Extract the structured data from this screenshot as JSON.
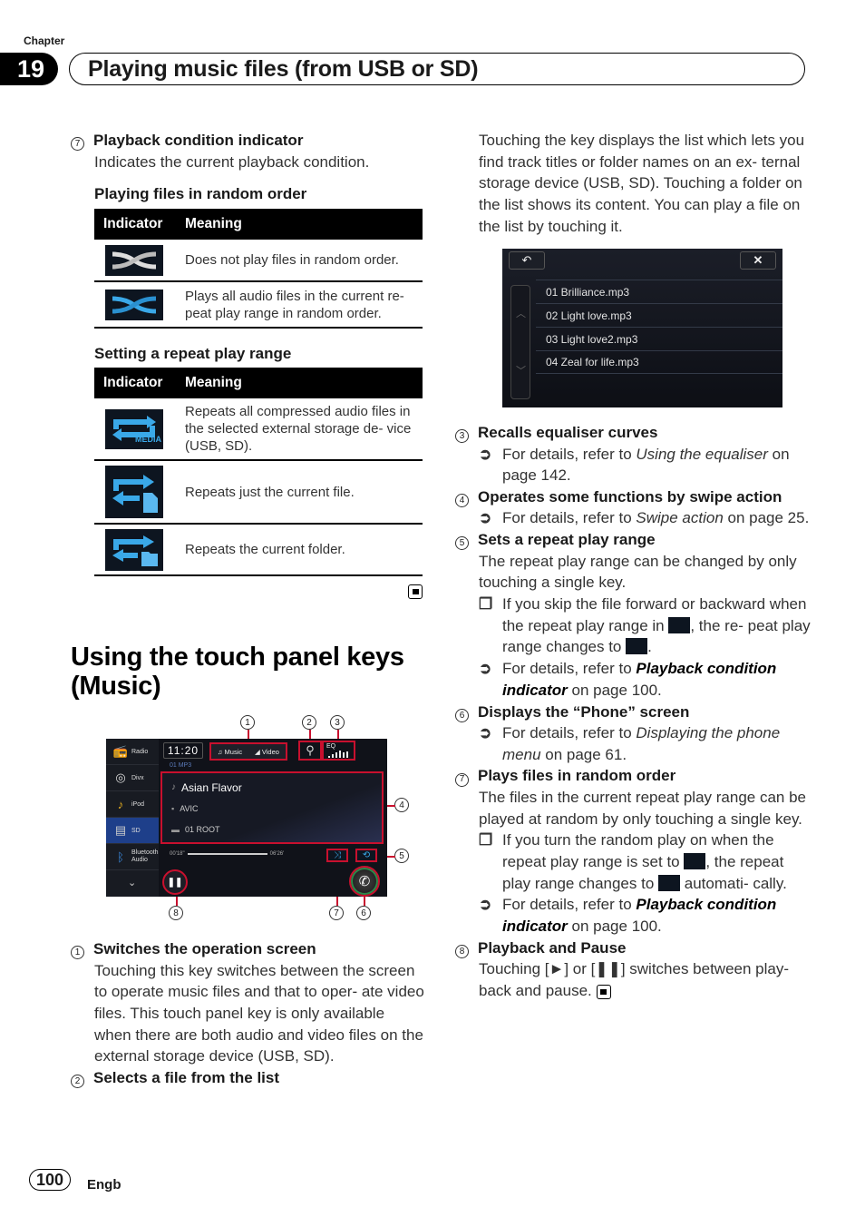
{
  "header": {
    "chapter_label": "Chapter",
    "chapter_number": "19",
    "chapter_title": "Playing music files (from USB or SD)"
  },
  "left": {
    "item7": {
      "num": "7",
      "title": "Playback condition indicator",
      "desc": "Indicates the current playback condition."
    },
    "random_table": {
      "heading": "Playing files in random order",
      "col_indicator": "Indicator",
      "col_meaning": "Meaning",
      "rows": [
        {
          "icon": "shuffle-off-icon",
          "meaning": "Does not play files in random order."
        },
        {
          "icon": "shuffle-on-icon",
          "meaning": "Plays all audio files in the current re- peat play range in random order."
        }
      ]
    },
    "repeat_table": {
      "heading": "Setting a repeat play range",
      "col_indicator": "Indicator",
      "col_meaning": "Meaning",
      "rows": [
        {
          "icon": "repeat-media-icon",
          "icon_label": "MEDIA",
          "meaning": "Repeats all compressed audio files in the selected external storage de- vice (USB, SD)."
        },
        {
          "icon": "repeat-file-icon",
          "meaning": "Repeats just the current file."
        },
        {
          "icon": "repeat-folder-icon",
          "meaning": "Repeats the current folder."
        }
      ]
    },
    "section_heading_line1": "Using the touch panel keys",
    "section_heading_line2": "(Music)",
    "screen": {
      "sidebar": [
        "Radio",
        "Divx",
        "iPod",
        "SD",
        "Bluetooth Audio"
      ],
      "active_source": "SD",
      "clock": "11:20",
      "toggle_music": "♫ Music",
      "toggle_video": "◢ Video",
      "eq_label": "EQ",
      "track_no": "01    MP3",
      "song": "Asian Flavor",
      "artist": "AVIC",
      "folder": "01 ROOT",
      "elapsed": "00'18\"",
      "total": "06'26'",
      "callouts": [
        "1",
        "2",
        "3",
        "4",
        "5",
        "6",
        "7",
        "8"
      ]
    },
    "item1": {
      "num": "1",
      "title": "Switches the operation screen",
      "desc": "Touching this key switches between the screen to operate music files and that to oper- ate video files. This touch panel key is only available when there are both audio and video files on the external storage device (USB, SD)."
    },
    "item2": {
      "num": "2",
      "title": "Selects a file from the list"
    }
  },
  "right": {
    "intro": "Touching the key displays the list which lets you find track titles or folder names on an ex- ternal storage device (USB, SD). Touching a folder on the list shows its content. You can play a file on the list by touching it.",
    "file_list": {
      "back_label": "↶",
      "close_label": "✕",
      "files": [
        "01 Brilliance.mp3",
        "02 Light love.mp3",
        "03 Light love2.mp3",
        "04 Zeal for life.mp3"
      ]
    },
    "item3": {
      "num": "3",
      "title": "Recalls equaliser curves",
      "ref_pre": "For details, refer to ",
      "ref_link": "Using the equaliser",
      "ref_post": " on page 142."
    },
    "item4": {
      "num": "4",
      "title": "Operates some functions by swipe action",
      "ref_pre": "For details, refer to ",
      "ref_link": "Swipe action",
      "ref_post": " on page 25."
    },
    "item5": {
      "num": "5",
      "title": "Sets a repeat play range",
      "desc": "The repeat play range can be changed by only touching a single key.",
      "note_pre": "If you skip the file forward or backward when the repeat play range in ",
      "note_mid": ", the re- peat play range changes to ",
      "note_post": ".",
      "ref_pre": "For details, refer to ",
      "ref_link": "Playback condition indicator",
      "ref_post": " on page 100."
    },
    "item6": {
      "num": "6",
      "title": "Displays the “Phone” screen",
      "ref_pre": "For details, refer to ",
      "ref_link": "Displaying the phone menu",
      "ref_post": " on page 61."
    },
    "item7": {
      "num": "7",
      "title": "Plays files in random order",
      "desc": "The files in the current repeat play range can be played at random by only touching a single key.",
      "note_pre": "If you turn the random play on when the repeat play range is set to ",
      "note_mid": ", the repeat play range changes to ",
      "note_post": " automati- cally.",
      "ref_pre": "For details, refer to ",
      "ref_link": "Playback condition indicator",
      "ref_post": " on page 100."
    },
    "item8": {
      "num": "8",
      "title": "Playback and Pause",
      "desc": "Touching [►] or [❚❚] switches between play- back and pause."
    }
  },
  "footer": {
    "page_number": "100",
    "language": "Engb"
  },
  "colors": {
    "accent_red": "#c8102e",
    "icon_blue": "#3aa8e8",
    "active_source_blue": "#1e3f8a"
  }
}
